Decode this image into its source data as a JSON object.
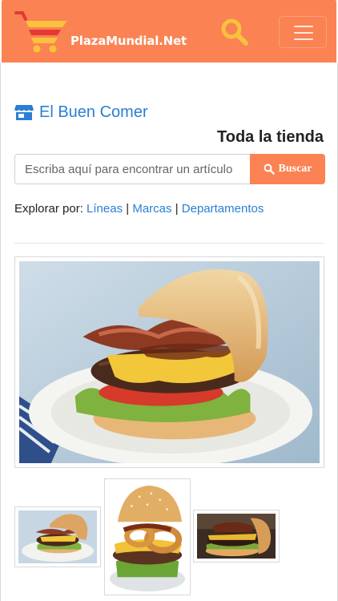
{
  "header": {
    "logo_text": "PlazaMundial.Net",
    "brand_color": "#fb8253"
  },
  "icons": {
    "logo": "shopping-cart-logo-icon",
    "search": "search-icon",
    "menu": "hamburger-menu-icon",
    "store": "store-icon"
  },
  "store": {
    "name": "El Buen Comer",
    "scope": "Toda la tienda"
  },
  "search": {
    "placeholder": "Escriba aquí para encontrar un artículo",
    "button_label": "Buscar"
  },
  "explore": {
    "prefix": "Explorar por:",
    "links": [
      "Líneas",
      "Marcas",
      "Departamentos"
    ],
    "separator": "|"
  },
  "gallery": {
    "main_image": "burger-bacon-cheese-photo",
    "thumbnails": [
      "burger-bacon-cheese-thumb",
      "burger-onion-rings-thumb",
      "burger-side-view-thumb"
    ]
  }
}
